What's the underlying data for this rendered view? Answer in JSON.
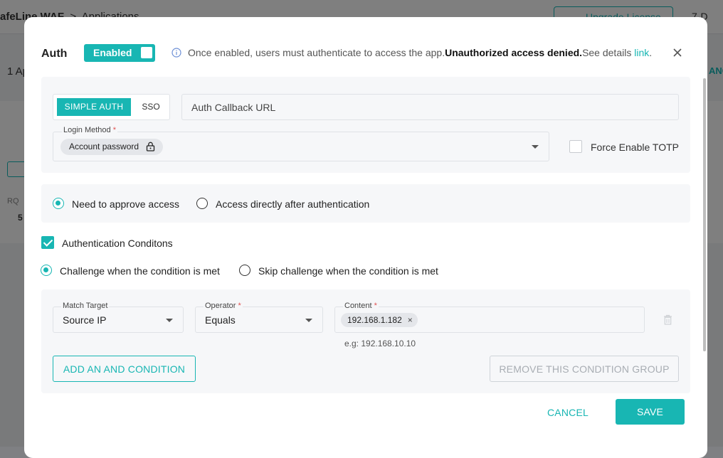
{
  "background": {
    "breadcrumb_app": "afeLine WAF",
    "breadcrumb_sep": ">",
    "breadcrumb_page": "Applications",
    "upgrade_label": "Upgrade License",
    "right_text": "7-D",
    "count_text": "1 Ap",
    "right_text2": "ANC",
    "rq_label": "RQ",
    "rq_value": "5"
  },
  "dialog": {
    "title": "Auth",
    "toggle_label": "Enabled",
    "notice_text": "Once enabled, users must authenticate to access the app.",
    "notice_bold": "Unauthorized access denied.",
    "notice_suffix": "See details ",
    "notice_link": "link",
    "notice_end": ".",
    "auth_tabs": [
      "SIMPLE AUTH",
      "SSO"
    ],
    "callback_placeholder": "Auth Callback URL",
    "login_method": {
      "label": "Login Method",
      "required_mark": "*",
      "value": "Account password"
    },
    "force_totp_label": "Force Enable TOTP",
    "approval_options": [
      "Need to approve access",
      "Access directly after authentication"
    ],
    "conditions_label": "Authentication Conditons",
    "challenge_options": [
      "Challenge when the condition is met",
      "Skip challenge when the condition is met"
    ],
    "condition_group": {
      "match_target": {
        "label": "Match Target",
        "value": "Source IP"
      },
      "operator": {
        "label": "Operator",
        "required_mark": "*",
        "value": "Equals"
      },
      "content": {
        "label": "Content",
        "required_mark": "*",
        "tag": "192.168.1.182",
        "remove_glyph": "×",
        "hint": "e.g: 192.168.10.10"
      },
      "add_button": "ADD AN AND CONDITION",
      "remove_group_button": "REMOVE THIS CONDITION GROUP"
    },
    "cancel_label": "CANCEL",
    "save_label": "SAVE"
  },
  "colors": {
    "accent": "#18b6b3",
    "required": "#e05151"
  },
  "icons": [
    "info-icon",
    "close-icon",
    "lock-icon",
    "chevron-down-icon",
    "trash-icon"
  ]
}
